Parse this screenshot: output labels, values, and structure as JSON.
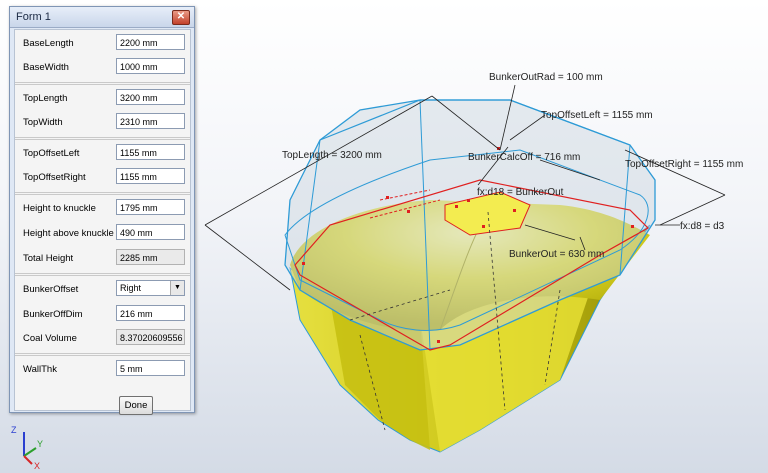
{
  "form": {
    "title": "Form 1",
    "rows": [
      {
        "label": "BaseLength",
        "value": "2200 mm"
      },
      {
        "label": "BaseWidth",
        "value": "1000 mm"
      },
      {
        "label": "TopLength",
        "value": "3200 mm"
      },
      {
        "label": "TopWidth",
        "value": "2310 mm"
      },
      {
        "label": "TopOffsetLeft",
        "value": "1155 mm"
      },
      {
        "label": "TopOffsetRight",
        "value": "1155 mm"
      },
      {
        "label": "Height to knuckle",
        "value": "1795 mm"
      },
      {
        "label": "Height above knuckle",
        "value": "490 mm"
      },
      {
        "label": "Total Height",
        "value": "2285 mm"
      },
      {
        "label": "BunkerOffset",
        "value": "Right"
      },
      {
        "label": "BunkerOffDim",
        "value": "216 mm"
      },
      {
        "label": "Coal Volume",
        "value": "8.37020609556"
      },
      {
        "label": "WallThk",
        "value": "5 mm"
      }
    ],
    "done_label": "Done"
  },
  "dimensions": {
    "bunker_out_rad": "BunkerOutRad = 100 mm",
    "top_offset_left": "TopOffsetLeft = 1155 mm",
    "top_length": "TopLength = 3200 mm",
    "bunker_calc_off": "BunkerCalcOff = 716 mm",
    "top_offset_right": "TopOffsetRight = 1155 mm",
    "fx_d18": "fx:d18 = BunkerOut",
    "fx_d8": "fx:d8 = d3",
    "bunker_out": "BunkerOut = 630 mm"
  },
  "triad": {
    "z": "Z",
    "y": "Y",
    "x": "X"
  },
  "colors": {
    "model": "#d8d21a",
    "glass": "#c7d2dc",
    "edge": "#2e9bd6",
    "sketch": "#e02020"
  }
}
